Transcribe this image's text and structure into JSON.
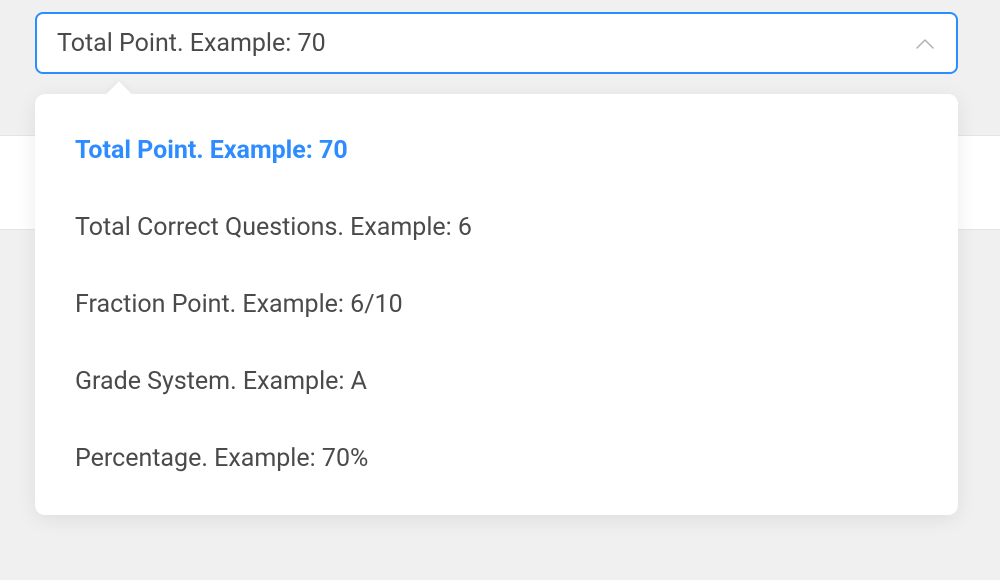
{
  "select": {
    "value": "Total Point. Example: 70",
    "options": [
      {
        "label": "Total Point. Example: 70",
        "selected": true
      },
      {
        "label": "Total Correct Questions. Example: 6",
        "selected": false
      },
      {
        "label": "Fraction Point. Example: 6/10",
        "selected": false
      },
      {
        "label": "Grade System. Example: A",
        "selected": false
      },
      {
        "label": "Percentage. Example: 70%",
        "selected": false
      }
    ]
  }
}
